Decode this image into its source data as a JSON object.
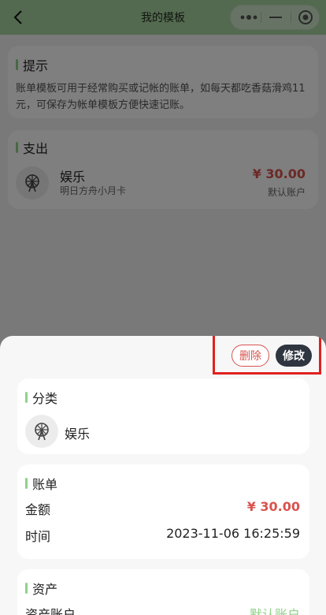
{
  "navbar": {
    "title": "我的模板"
  },
  "tip": {
    "title": "提示",
    "text": "账单模板可用于经常购买或记帐的账单，如每天都吃香菇滑鸡11元，可保存为帐单模板方便快速记账。"
  },
  "expense": {
    "title": "支出",
    "item": {
      "category": "娱乐",
      "note": "明日方舟小月卡",
      "amount": "¥ 30.00",
      "account": "默认账户"
    }
  },
  "sheet": {
    "delete_label": "删除",
    "edit_label": "修改",
    "category": {
      "title": "分类",
      "name": "娱乐"
    },
    "bill": {
      "title": "账单",
      "amount_label": "金额",
      "amount_value": "¥ 30.00",
      "time_label": "时间",
      "time_value": "2023-11-06 16:25:59"
    },
    "asset": {
      "title": "资产",
      "account_label": "资产账户",
      "account_value": "默认账户"
    }
  },
  "colors": {
    "accent": "#8fd28a",
    "navbar": "#a8d5a0",
    "amount": "#d9534f",
    "dark_button": "#2f3640"
  }
}
